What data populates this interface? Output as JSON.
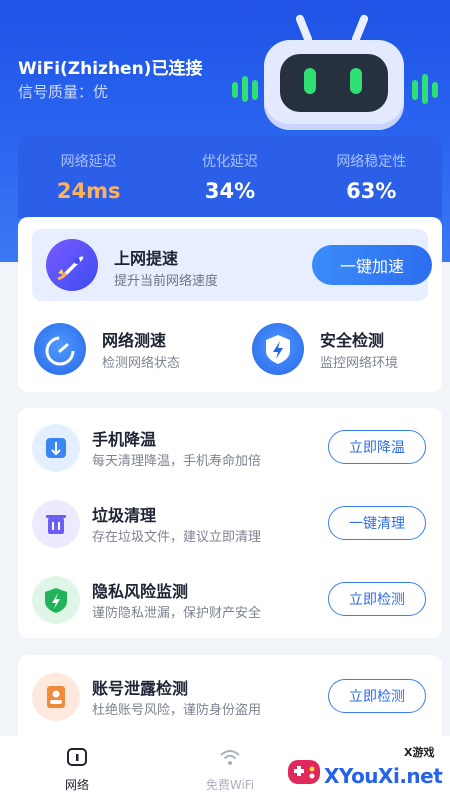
{
  "header": {
    "wifi_status": "WiFi(Zhizhen)已连接",
    "signal_quality": "信号质量：优"
  },
  "stats": [
    {
      "label": "网络延迟",
      "value": "24ms"
    },
    {
      "label": "优化延迟",
      "value": "34%"
    },
    {
      "label": "网络稳定性",
      "value": "63%"
    }
  ],
  "boost": {
    "title": "上网提速",
    "subtitle": "提升当前网络速度",
    "button": "一键加速"
  },
  "tools": [
    {
      "title": "网络测速",
      "subtitle": "检测网络状态"
    },
    {
      "title": "安全检测",
      "subtitle": "监控网络环境"
    }
  ],
  "rows": [
    {
      "title": "手机降温",
      "subtitle": "每天清理降温，手机寿命加倍",
      "button": "立即降温"
    },
    {
      "title": "垃圾清理",
      "subtitle": "存在垃圾文件，建议立即清理",
      "button": "一键清理"
    },
    {
      "title": "隐私风险监测",
      "subtitle": "谨防隐私泄漏，保护财产安全",
      "button": "立即检测"
    },
    {
      "title": "账号泄露检测",
      "subtitle": "杜绝账号风险，谨防身份盗用",
      "button": "立即检测"
    }
  ],
  "nav": [
    {
      "label": "网络"
    },
    {
      "label": "免费WiFi"
    }
  ],
  "watermark": {
    "text": "XYouXi.net",
    "small": "X游戏"
  },
  "colors": {
    "primary": "#2c5fe8",
    "accent_orange": "#ffb25a",
    "green": "#2ee074"
  }
}
